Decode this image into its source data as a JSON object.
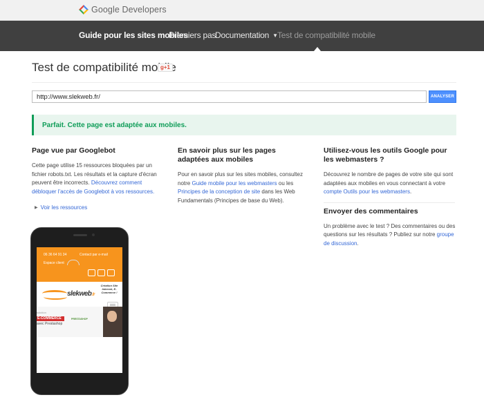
{
  "header": {
    "brand": "Google Developers"
  },
  "nav": {
    "items": [
      {
        "label": "Guide pour les sites mobiles"
      },
      {
        "label": "Premiers pas"
      },
      {
        "label": "Documentation"
      },
      {
        "label": "Test de compatibilité mobile"
      }
    ]
  },
  "page": {
    "title": "Test de compatibilité mobile",
    "gplus_label": "g+1"
  },
  "url_form": {
    "value": "http://www.slekweb.fr/",
    "button_label": "ANALYSER"
  },
  "result": {
    "message": "Parfait. Cette page est adaptée aux mobiles."
  },
  "col1": {
    "heading": "Page vue par Googlebot",
    "text_before": "Cette page utilise 15 ressources bloquées par un fichier robots.txt. Les résultats et la capture d'écran peuvent être incorrects.",
    "link": "Découvrez comment débloquer l'accès de Googlebot à vos ressources.",
    "resources_link": "Voir les ressources"
  },
  "col2": {
    "heading": "En savoir plus sur les pages adaptées aux mobiles",
    "t1": "Pour en savoir plus sur les sites mobiles, consultez notre",
    "link1": "Guide mobile pour les webmasters",
    "t2": "ou les",
    "link2": "Principes de la conception de site",
    "t3": "dans les Web Fundamentals (Principes de base du Web)."
  },
  "col3": {
    "heading": "Utilisez-vous les outils Google pour les webmasters ?",
    "t1": "Découvrez le nombre de pages de votre site qui sont adaptées aux mobiles en vous connectant à votre",
    "link1": "compte Outils pour les webmasters",
    "t1_end": ".",
    "heading2": "Envoyer des commentaires",
    "t2": "Un problème avec le test ? Des commentaires ou des questions sur les résultats ? Publiez sur notre",
    "link2": "groupe de discussion",
    "t2_end": "."
  },
  "phone_screen": {
    "phone_number": "06 36 64 91 34",
    "contact": "Contact par e-mail",
    "client": "Espace client",
    "logo": "slekweb",
    "logo_suffix": ".fr",
    "tagline": "Création Site Internet, E-Commerce !",
    "banner_line1": "solution",
    "banner_ecommerce": "E-COMMERCE",
    "banner_line3": "avec Prestashop",
    "shop_label": "PRESTASHOP"
  },
  "colors": {
    "accent_blue": "#4d90fe",
    "success_green": "#0f9d58",
    "nav_bg": "#404040",
    "screen_orange": "#f7941d"
  }
}
